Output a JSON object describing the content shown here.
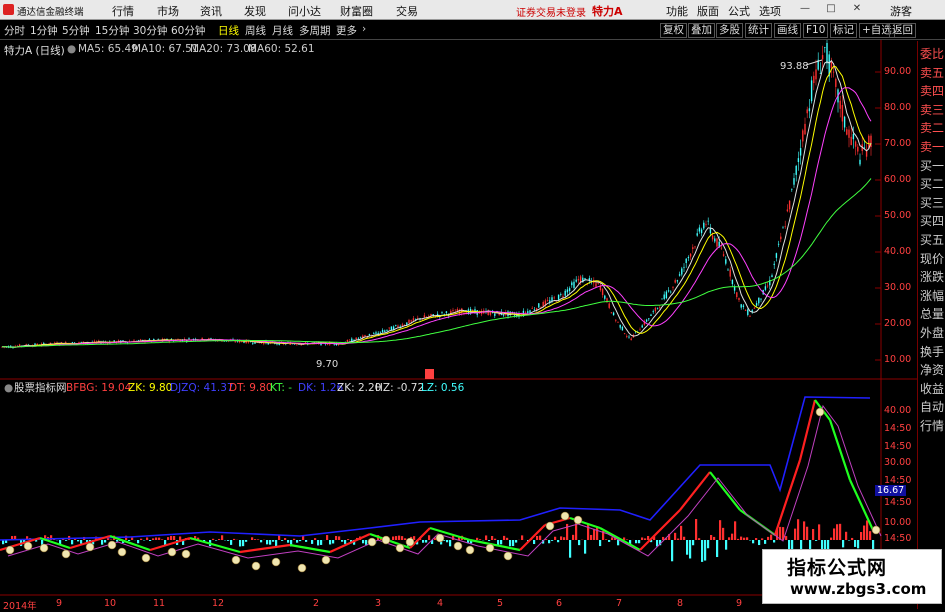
{
  "menubar": {
    "app_title": "通达信金融终端",
    "items": [
      "行情",
      "市场",
      "资讯",
      "发现",
      "问小达",
      "财富圈",
      "交易"
    ],
    "login_status": "证券交易未登录",
    "stock_name": "特力A",
    "right_items": [
      "功能",
      "版面",
      "公式",
      "选项"
    ],
    "window_controls": [
      "—",
      "□",
      "✕"
    ],
    "guest": "游客"
  },
  "toolbar": {
    "periods": [
      "分时",
      "1分钟",
      "5分钟",
      "15分钟",
      "30分钟",
      "60分钟",
      "日线",
      "周线",
      "月线",
      "多周期",
      "更多"
    ],
    "active_period": "日线",
    "right_buttons": [
      "复权",
      "叠加",
      "多股",
      "统计",
      "画线",
      "F10",
      "标记",
      "+自选",
      "返回"
    ]
  },
  "main_chart": {
    "title": "特力A (日线)",
    "ma": [
      {
        "label": "MA5: 65.49",
        "color": "#e0e0e0"
      },
      {
        "label": "MA10: 67.51",
        "color": "#ffff00"
      },
      {
        "label": "MA20: 73.08",
        "color": "#ff40ff"
      },
      {
        "label": "MA60: 52.61",
        "color": "#40ff40"
      }
    ],
    "high_label": "93.88",
    "low_label": "9.70",
    "y_ticks": [
      "90.00",
      "80.00",
      "70.00",
      "60.00",
      "50.00",
      "40.00",
      "30.00",
      "20.00",
      "10.00"
    ]
  },
  "indicator": {
    "title": "股票指标网",
    "items": [
      {
        "label": "BFBG: 19.04",
        "color": "#ff4040"
      },
      {
        "label": "ZK: 9.80",
        "color": "#ffff00"
      },
      {
        "label": "DJZQ: 41.37",
        "color": "#4040ff"
      },
      {
        "label": "DT: 9.80",
        "color": "#ff4040"
      },
      {
        "label": "KT: -",
        "color": "#40ff40"
      },
      {
        "label": "DK: 1.26",
        "color": "#4040ff"
      },
      {
        "label": "ZK: 2.20",
        "color": "#e0e0e0"
      },
      {
        "label": "HZ: -0.72",
        "color": "#e0e0e0"
      },
      {
        "label": "LZ: 0.56",
        "color": "#40ffff"
      }
    ],
    "y_ticks": [
      "40.00",
      "14:50",
      "14:50",
      "30.00",
      "14:50",
      "14:50",
      "10.00",
      "14:50"
    ],
    "current_value": "16.67"
  },
  "x_axis": {
    "labels": [
      "2014年",
      "9",
      "10",
      "11",
      "12",
      "2",
      "3",
      "4",
      "5",
      "6",
      "7",
      "8",
      "9"
    ]
  },
  "right_panel": {
    "items": [
      "委比",
      "卖五",
      "卖四",
      "卖三",
      "卖二",
      "卖一",
      "买一",
      "买二",
      "买三",
      "买四",
      "买五",
      "现价",
      "涨跌",
      "涨幅",
      "总量",
      "外盘",
      "换手",
      "净资",
      "收益",
      "自动",
      "行情"
    ]
  },
  "watermark": {
    "title": "指标公式网",
    "url": "www.zbgs3.com"
  }
}
